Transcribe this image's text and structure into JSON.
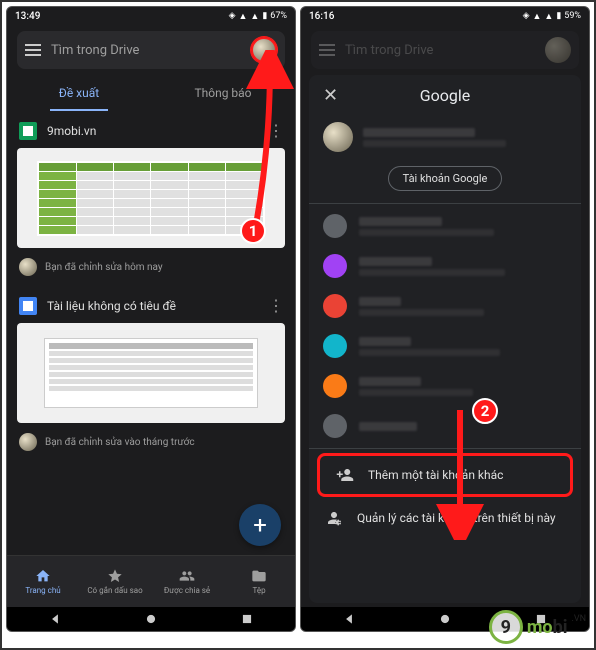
{
  "left": {
    "status": {
      "time": "13:49",
      "battery": "67%"
    },
    "search_placeholder": "Tìm trong Drive",
    "tabs": {
      "suggested": "Đề xuất",
      "notifications": "Thông báo"
    },
    "file1": {
      "title": "9mobi.vn",
      "meta": "Bạn đã chỉnh sửa hôm nay"
    },
    "file2": {
      "title": "Tài liệu không có tiêu đề",
      "meta": "Bạn đã chỉnh sửa vào tháng trước"
    },
    "fab": "+",
    "nav": {
      "home": "Trang chủ",
      "starred": "Có gắn dấu sao",
      "shared": "Được chia sẻ",
      "files": "Tệp"
    }
  },
  "right": {
    "status": {
      "time": "16:16",
      "battery": "59%"
    },
    "search_placeholder": "Tìm trong Drive",
    "sheet_title": "Google",
    "google_account_btn": "Tài khoản Google",
    "add_account": "Thêm một tài khoản khác",
    "manage_accounts": "Quản lý các tài khoản trên thiết bị này"
  },
  "badges": {
    "one": "1",
    "two": "2"
  },
  "watermark": {
    "nine": "9",
    "mo": "mo",
    "bi": "bi",
    "vn": ".VN"
  }
}
